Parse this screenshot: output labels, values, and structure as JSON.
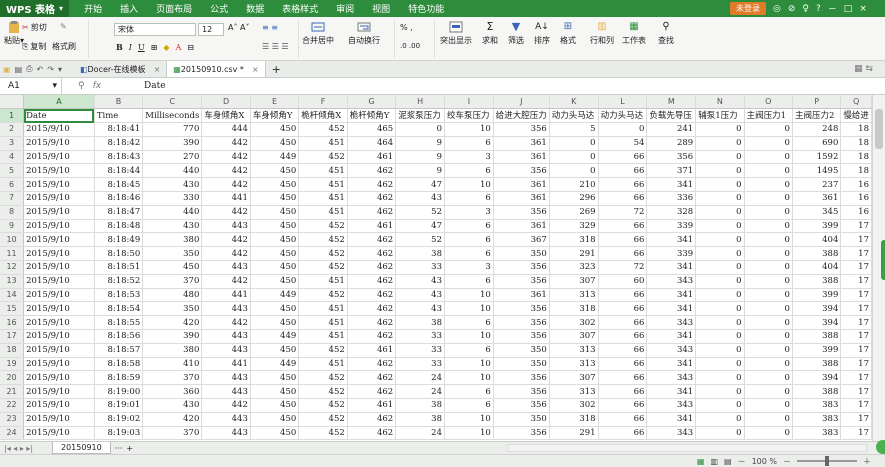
{
  "app": {
    "badge": "WPS 表格",
    "menu": [
      "开始",
      "插入",
      "页面布局",
      "公式",
      "数据",
      "表格样式",
      "审阅",
      "视图",
      "特色功能"
    ],
    "login": "未登录",
    "window_controls": [
      "◎",
      "⊘",
      "♀",
      "?",
      "－",
      "□",
      "×"
    ]
  },
  "ribbon": {
    "cut": "剪切",
    "copy": "复制",
    "paste": "粘贴",
    "format_painter": "格式刷",
    "font_name": "宋体",
    "font_size": "12",
    "bold": "B",
    "italic": "I",
    "underline": "U",
    "merge": "合并居中",
    "wrap": "自动换行",
    "number_format": "% ,",
    "cond_format": "突出显示",
    "sum": "求和",
    "filter": "筛选",
    "sort": "排序",
    "style": "格式",
    "rowcol": "行和列",
    "sheet": "工作表",
    "find": "查找"
  },
  "tabs": [
    {
      "label": "Docer-在线模板",
      "active": false
    },
    {
      "label": "20150910.csv *",
      "active": true
    }
  ],
  "formula_bar": {
    "cell_ref": "A1",
    "value": "Date"
  },
  "columns": [
    "A",
    "B",
    "C",
    "D",
    "E",
    "F",
    "G",
    "H",
    "I",
    "J",
    "K",
    "L",
    "M",
    "N",
    "O",
    "P",
    "Q"
  ],
  "header_row": [
    "Date",
    "Time",
    "Milliseconds",
    "车身倾角X",
    "车身倾角Y",
    "桅杆倾角X",
    "桅杆倾角Y",
    "泥浆泵压力",
    "绞车泵压力",
    "给进大腔压力",
    "动力头马达",
    "动力头马达",
    "负载先导压",
    "辅泵1压力",
    "主阀压力1",
    "主阀压力2",
    "慢给进"
  ],
  "rows": [
    [
      "2015/9/10",
      "8:18:41",
      "770",
      "444",
      "450",
      "452",
      "465",
      "0",
      "10",
      "356",
      "5",
      "0",
      "241",
      "0",
      "0",
      "248",
      "18"
    ],
    [
      "2015/9/10",
      "8:18:42",
      "390",
      "442",
      "450",
      "451",
      "464",
      "9",
      "6",
      "361",
      "0",
      "54",
      "289",
      "0",
      "0",
      "690",
      "18"
    ],
    [
      "2015/9/10",
      "8:18:43",
      "270",
      "442",
      "449",
      "452",
      "461",
      "9",
      "3",
      "361",
      "0",
      "66",
      "356",
      "0",
      "0",
      "1592",
      "18"
    ],
    [
      "2015/9/10",
      "8:18:44",
      "440",
      "442",
      "450",
      "451",
      "462",
      "9",
      "6",
      "356",
      "0",
      "66",
      "371",
      "0",
      "0",
      "1495",
      "18"
    ],
    [
      "2015/9/10",
      "8:18:45",
      "430",
      "442",
      "450",
      "451",
      "462",
      "47",
      "10",
      "361",
      "210",
      "66",
      "341",
      "0",
      "0",
      "237",
      "16"
    ],
    [
      "2015/9/10",
      "8:18:46",
      "330",
      "441",
      "450",
      "451",
      "462",
      "43",
      "6",
      "361",
      "296",
      "66",
      "336",
      "0",
      "0",
      "361",
      "16"
    ],
    [
      "2015/9/10",
      "8:18:47",
      "440",
      "442",
      "450",
      "451",
      "462",
      "52",
      "3",
      "356",
      "269",
      "72",
      "328",
      "0",
      "0",
      "345",
      "16"
    ],
    [
      "2015/9/10",
      "8:18:48",
      "430",
      "443",
      "450",
      "452",
      "461",
      "47",
      "6",
      "361",
      "329",
      "66",
      "339",
      "0",
      "0",
      "399",
      "17"
    ],
    [
      "2015/9/10",
      "8:18:49",
      "380",
      "442",
      "450",
      "452",
      "462",
      "52",
      "6",
      "367",
      "318",
      "66",
      "341",
      "0",
      "0",
      "404",
      "17"
    ],
    [
      "2015/9/10",
      "8:18:50",
      "350",
      "442",
      "450",
      "452",
      "462",
      "38",
      "6",
      "350",
      "291",
      "66",
      "339",
      "0",
      "0",
      "388",
      "17"
    ],
    [
      "2015/9/10",
      "8:18:51",
      "450",
      "443",
      "450",
      "452",
      "462",
      "33",
      "3",
      "356",
      "323",
      "72",
      "341",
      "0",
      "0",
      "404",
      "17"
    ],
    [
      "2015/9/10",
      "8:18:52",
      "370",
      "442",
      "450",
      "451",
      "462",
      "43",
      "6",
      "356",
      "307",
      "60",
      "343",
      "0",
      "0",
      "388",
      "17"
    ],
    [
      "2015/9/10",
      "8:18:53",
      "480",
      "441",
      "449",
      "452",
      "462",
      "43",
      "10",
      "361",
      "313",
      "66",
      "341",
      "0",
      "0",
      "399",
      "17"
    ],
    [
      "2015/9/10",
      "8:18:54",
      "350",
      "443",
      "450",
      "451",
      "462",
      "43",
      "10",
      "356",
      "318",
      "66",
      "341",
      "0",
      "0",
      "394",
      "17"
    ],
    [
      "2015/9/10",
      "8:18:55",
      "420",
      "442",
      "450",
      "451",
      "462",
      "38",
      "6",
      "356",
      "302",
      "66",
      "343",
      "0",
      "0",
      "394",
      "17"
    ],
    [
      "2015/9/10",
      "8:18:56",
      "390",
      "443",
      "449",
      "451",
      "462",
      "33",
      "10",
      "356",
      "307",
      "66",
      "341",
      "0",
      "0",
      "388",
      "17"
    ],
    [
      "2015/9/10",
      "8:18:57",
      "380",
      "443",
      "450",
      "452",
      "461",
      "33",
      "6",
      "350",
      "313",
      "66",
      "343",
      "0",
      "0",
      "399",
      "17"
    ],
    [
      "2015/9/10",
      "8:18:58",
      "410",
      "441",
      "449",
      "451",
      "462",
      "33",
      "10",
      "350",
      "313",
      "66",
      "341",
      "0",
      "0",
      "388",
      "17"
    ],
    [
      "2015/9/10",
      "8:18:59",
      "370",
      "443",
      "450",
      "452",
      "462",
      "24",
      "10",
      "356",
      "307",
      "66",
      "343",
      "0",
      "0",
      "394",
      "17"
    ],
    [
      "2015/9/10",
      "8:19:00",
      "360",
      "443",
      "450",
      "452",
      "462",
      "24",
      "6",
      "356",
      "313",
      "66",
      "341",
      "0",
      "0",
      "388",
      "17"
    ],
    [
      "2015/9/10",
      "8:19:01",
      "430",
      "442",
      "450",
      "452",
      "461",
      "38",
      "6",
      "356",
      "302",
      "66",
      "343",
      "0",
      "0",
      "383",
      "17"
    ],
    [
      "2015/9/10",
      "8:19:02",
      "420",
      "443",
      "450",
      "452",
      "462",
      "38",
      "10",
      "350",
      "318",
      "66",
      "341",
      "0",
      "0",
      "383",
      "17"
    ],
    [
      "2015/9/10",
      "8:19:03",
      "370",
      "443",
      "450",
      "452",
      "462",
      "24",
      "10",
      "356",
      "291",
      "66",
      "343",
      "0",
      "0",
      "383",
      "17"
    ]
  ],
  "sheet": {
    "name": "20150910",
    "add": "+"
  },
  "status": {
    "zoom": "100 %",
    "zoom_minus": "－",
    "zoom_plus": "＋"
  },
  "colors": {
    "accent": "#2d8d3c",
    "login": "#e07b28"
  }
}
